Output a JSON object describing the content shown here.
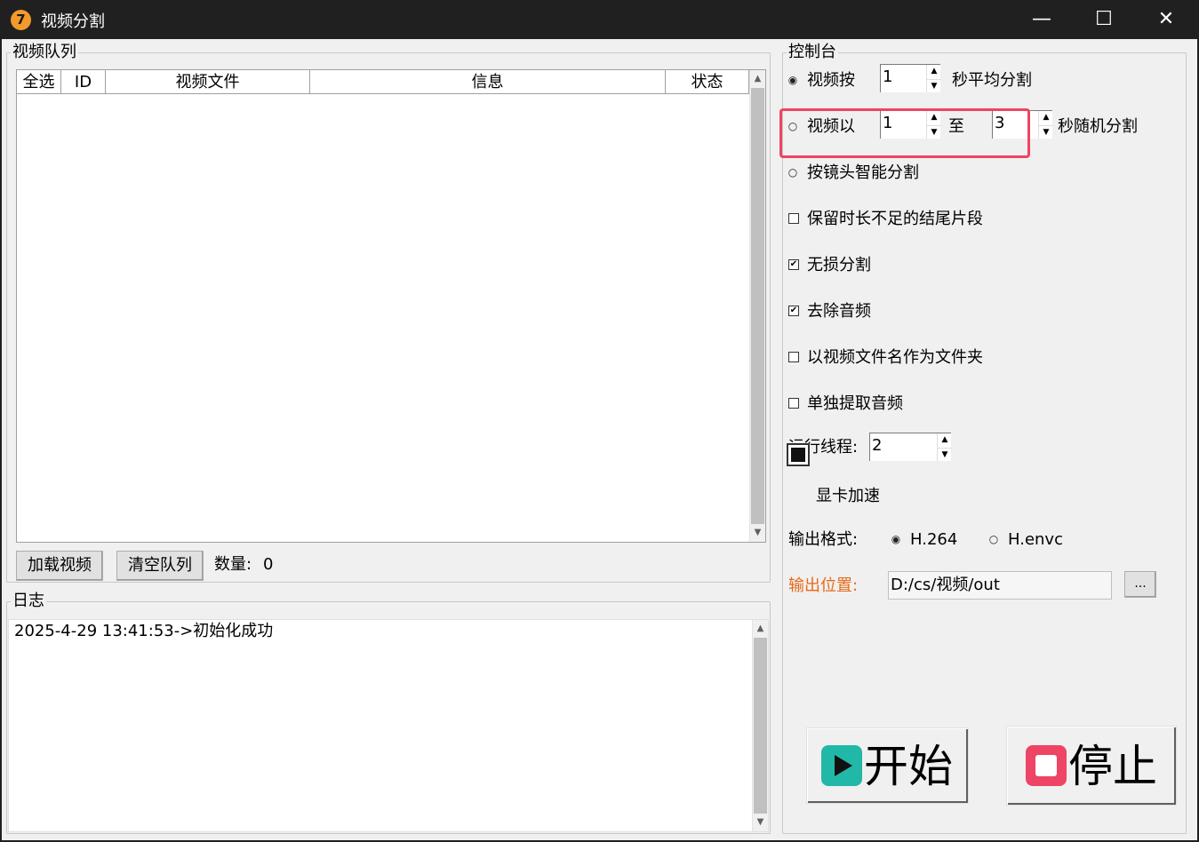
{
  "window": {
    "title": "视频分割",
    "icon_text": "7",
    "minimize": "—",
    "maximize": "☐",
    "close": "✕"
  },
  "queue": {
    "group_title": "视频队列",
    "columns": [
      "全选",
      "ID",
      "视频文件",
      "信息",
      "状态"
    ],
    "load_button": "加载视频",
    "clear_button": "清空队列",
    "count_label": "数量:",
    "count_value": "0"
  },
  "log": {
    "group_title": "日志",
    "lines": [
      "2025-4-29 13:41:53->初始化成功"
    ]
  },
  "control": {
    "group_title": "控制台",
    "mode_avg_prefix": "视频按",
    "mode_avg_value": "1",
    "mode_avg_suffix": "秒平均分割",
    "mode_random_prefix": "视频以",
    "mode_random_min": "1",
    "mode_random_to": "至",
    "mode_random_max": "3",
    "mode_random_suffix": "秒随机分割",
    "mode_smart": "按镜头智能分割",
    "keep_tail": "保留时长不足的结尾片段",
    "lossless": "无损分割",
    "remove_audio": "去除音频",
    "folder_by_name": "以视频文件名作为文件夹",
    "extract_audio": "单独提取音频",
    "threads_label": "运行线程:",
    "threads_value": "2",
    "gpu_label": "显卡加速",
    "format_label": "输出格式:",
    "format_h264": "H.264",
    "format_henvc": "H.envc",
    "output_label": "输出位置:",
    "output_path": "D:/cs/视频/out",
    "browse_button": "...",
    "start_button": "开始",
    "stop_button": "停止"
  },
  "colors": {
    "accent_red": "#ee4460",
    "output_label": "#e86a1a",
    "play_icon": "#21b8a7",
    "stop_icon": "#ee4466"
  }
}
